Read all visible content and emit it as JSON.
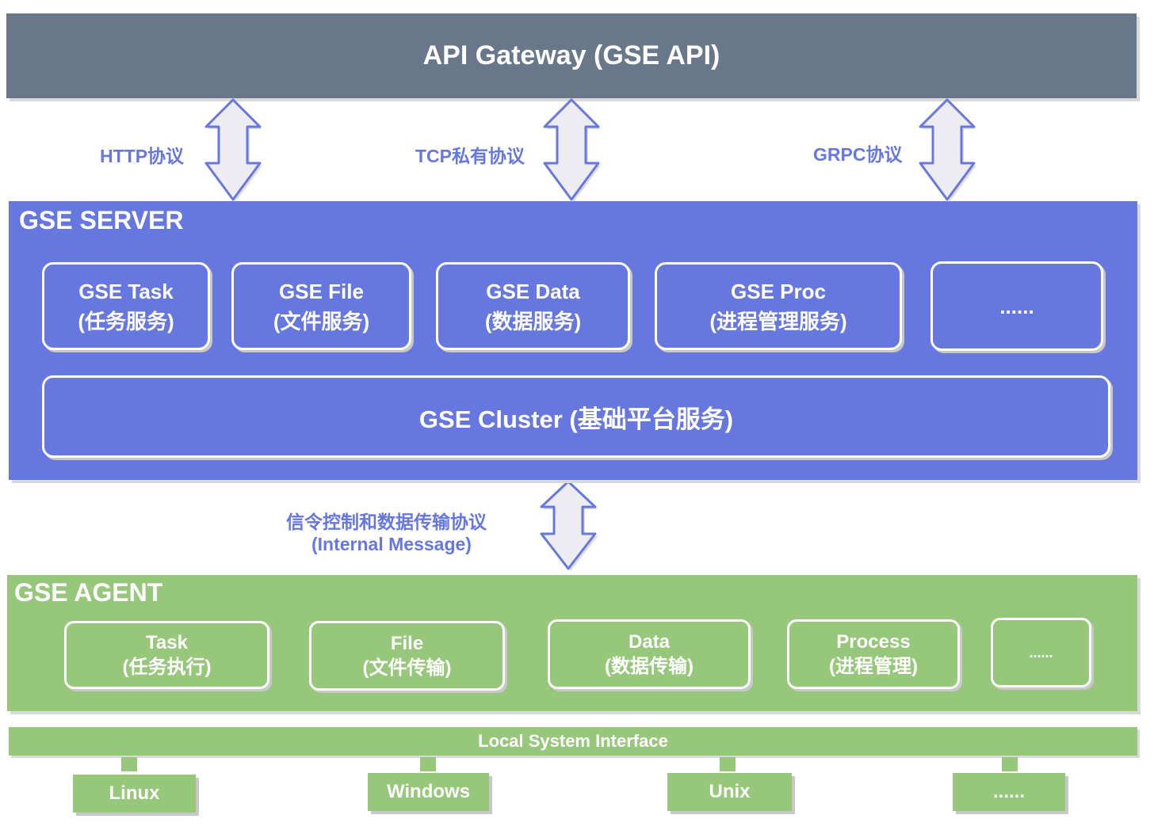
{
  "gateway": {
    "title": "API Gateway (GSE API)"
  },
  "protocols": {
    "http": "HTTP协议",
    "tcp": "TCP私有协议",
    "grpc": "GRPC协议",
    "internal_line1": "信令控制和数据传输协议",
    "internal_line2": "(Internal Message)"
  },
  "server": {
    "title": "GSE SERVER",
    "modules": [
      {
        "name": "GSE Task",
        "desc": "(任务服务)"
      },
      {
        "name": "GSE File",
        "desc": "(文件服务)"
      },
      {
        "name": "GSE Data",
        "desc": "(数据服务)"
      },
      {
        "name": "GSE Proc",
        "desc": "(进程管理服务)"
      },
      {
        "name": "......",
        "desc": ""
      }
    ],
    "cluster": "GSE Cluster (基础平台服务)"
  },
  "agent": {
    "title": "GSE AGENT",
    "modules": [
      {
        "name": "Task",
        "desc": "(任务执行)"
      },
      {
        "name": "File",
        "desc": "(文件传输)"
      },
      {
        "name": "Data",
        "desc": "(数据传输)"
      },
      {
        "name": "Process",
        "desc": "(进程管理)"
      },
      {
        "name": "......",
        "desc": ""
      }
    ]
  },
  "local_system_interface": "Local System Interface",
  "os": [
    "Linux",
    "Windows",
    "Unix",
    "......"
  ],
  "colors": {
    "gateway": "#68778a",
    "server": "#6777e0",
    "agent": "#97c77b",
    "arrow_fill": "#ececf2",
    "arrow_stroke": "#6777e0"
  }
}
